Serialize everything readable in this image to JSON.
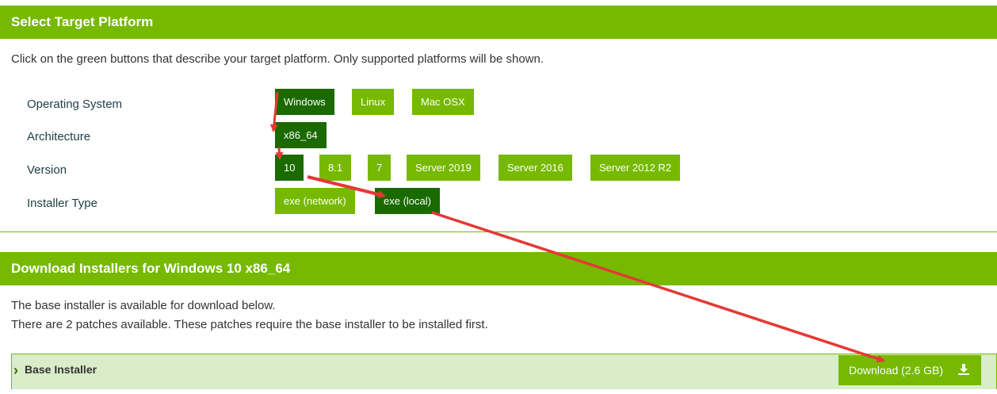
{
  "section1": {
    "title": "Select Target Platform",
    "intro": "Click on the green buttons that describe your target platform. Only supported platforms will be shown."
  },
  "rows": {
    "os": {
      "label": "Operating System",
      "options": [
        "Windows",
        "Linux",
        "Mac OSX"
      ],
      "selected": "Windows"
    },
    "arch": {
      "label": "Architecture",
      "options": [
        "x86_64"
      ],
      "selected": "x86_64"
    },
    "version": {
      "label": "Version",
      "options": [
        "10",
        "8.1",
        "7",
        "Server 2019",
        "Server 2016",
        "Server 2012 R2"
      ],
      "selected": "10"
    },
    "installer": {
      "label": "Installer Type",
      "options": [
        "exe (network)",
        "exe (local)"
      ],
      "selected": "exe (local)"
    }
  },
  "section2": {
    "title": "Download Installers for Windows 10 x86_64",
    "line1": "The base installer is available for download below.",
    "line2": "There are 2 patches available. These patches require the base installer to be installed first."
  },
  "base_installer": {
    "title": "Base Installer",
    "download_label": "Download (2.6 GB)"
  },
  "colors": {
    "brand_green": "#76b900",
    "selected_green": "#1a6a00",
    "annotation_red": "#e53935"
  },
  "icons": {
    "expand": "chevron-right-icon",
    "download": "download-icon"
  }
}
